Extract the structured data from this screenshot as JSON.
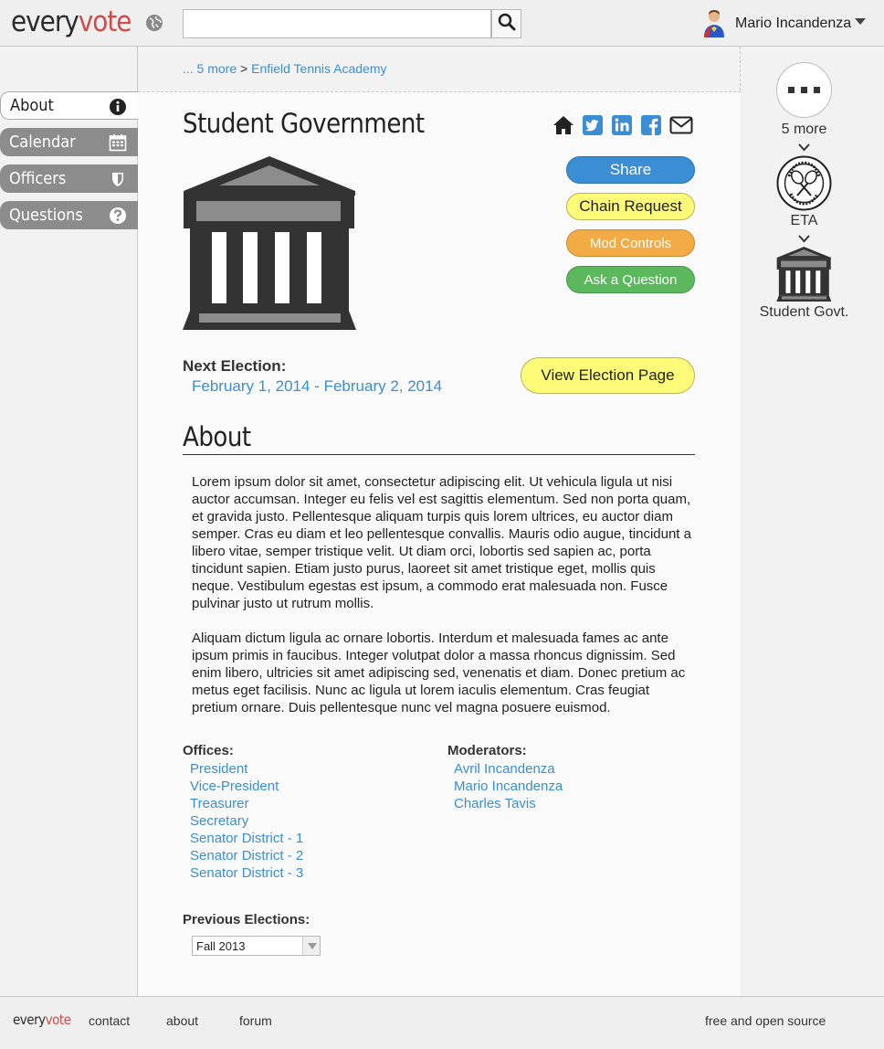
{
  "header": {
    "logo_every": "every",
    "logo_vote": "vote",
    "search_placeholder": "",
    "user_name": "Mario Incandenza"
  },
  "sidebar": {
    "items": [
      {
        "label": "About",
        "icon": "info-icon",
        "active": true
      },
      {
        "label": "Calendar",
        "icon": "calendar-icon",
        "active": false
      },
      {
        "label": "Officers",
        "icon": "shield-icon",
        "active": false
      },
      {
        "label": "Questions",
        "icon": "question-icon",
        "active": false
      }
    ]
  },
  "breadcrumb": {
    "more": "... 5 more",
    "separator": ">",
    "current": "Enfield Tennis Academy"
  },
  "main": {
    "title": "Student Government",
    "share_icons": [
      "home-icon",
      "twitter-icon",
      "linkedin-icon",
      "facebook-icon",
      "email-icon"
    ],
    "buttons": {
      "share": "Share",
      "chain": "Chain Request",
      "mod": "Mod Controls",
      "ask": "Ask a Question",
      "view_election": "View Election Page"
    },
    "next_election_label": "Next Election:",
    "next_election_dates": "February 1, 2014 - February 2, 2014",
    "about_heading": "About",
    "about_p1": "Lorem ipsum dolor sit amet, consectetur adipiscing elit. Ut vehicula ligula ut nisi auctor accumsan. Integer eu felis vel est sagittis elementum. Sed non porta quam, et gravida justo. Pellentesque aliquam turpis quis lorem ultrices, eu auctor diam semper. Cras eu diam et leo pellentesque convallis. Mauris odio augue, tincidunt a libero vitae, semper tristique velit. Ut diam orci, lobortis sed sapien ac, porta tincidunt sapien. Etiam justo purus, laoreet sit amet tristique eget, mollis quis neque. Vestibulum egestas est ipsum, a commodo erat malesuada non. Fusce pulvinar justo ut rutrum mollis.",
    "about_p2": "Aliquam dictum ligula ac ornare lobortis. Interdum et malesuada fames ac ante ipsum primis in faucibus. Integer volutpat dolor a massa rhoncus dignissim. Sed enim libero, ultricies sit amet adipiscing sed, venenatis et diam. Donec pretium ac metus eget facilisis. Nunc ac ligula ut lorem iaculis elementum. Cras feugiat pretium ornare. Duis pellentesque nunc vel magna posuere euismod.",
    "offices_label": "Offices:",
    "offices": [
      "President",
      "Vice-President",
      "Treasurer",
      "Secretary",
      "Senator District - 1",
      "Senator District - 2",
      "Senator District - 3"
    ],
    "moderators_label": "Moderators:",
    "moderators": [
      "Avril Incandenza",
      "Mario Incandenza",
      "Charles Tavis"
    ],
    "previous_label": "Previous Elections:",
    "previous_selected": "Fall 2013"
  },
  "rightnav": {
    "more_label": "5 more",
    "eta_label": "ETA",
    "gov_label": "Student Govt."
  },
  "footer": {
    "logo_every": "every",
    "logo_vote": "vote",
    "contact": "contact",
    "about": "about",
    "forum": "forum",
    "foss": "free and open source"
  }
}
